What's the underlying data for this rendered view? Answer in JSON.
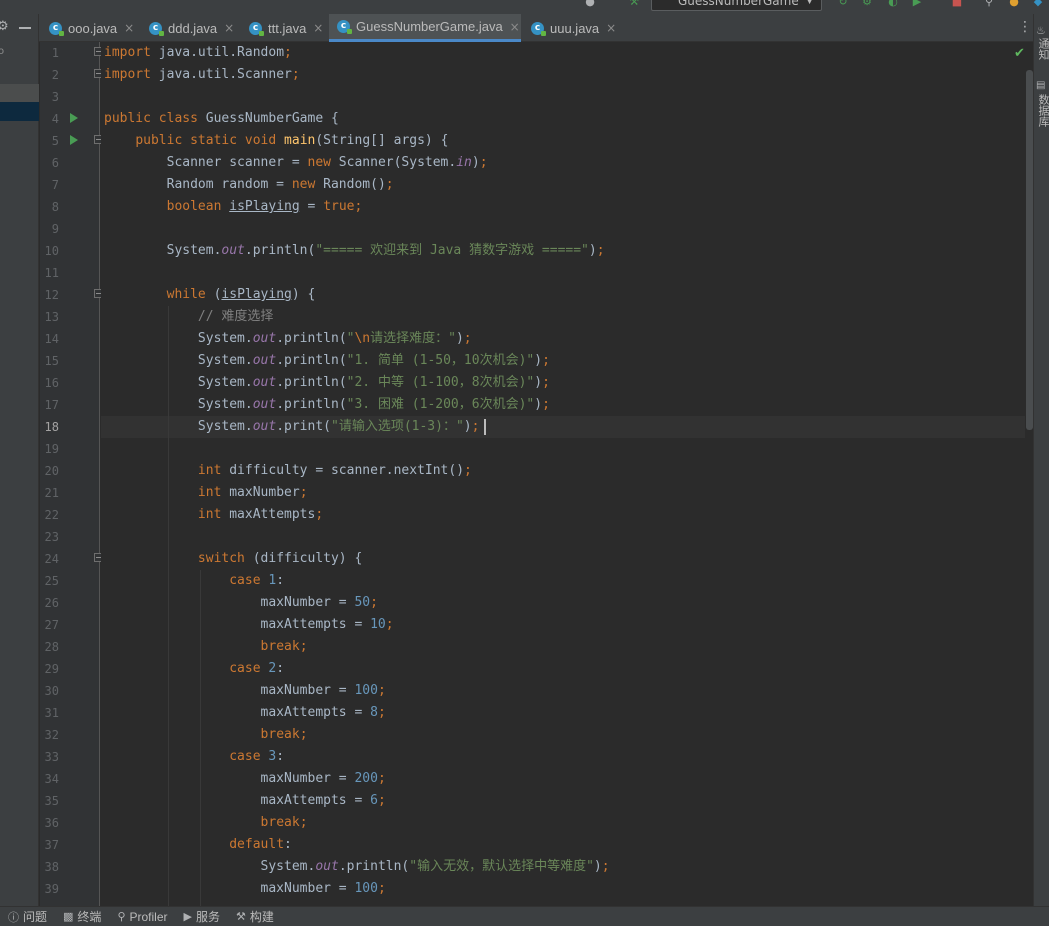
{
  "toolbar": {
    "run_config": "GuessNumberGame",
    "icons": [
      "user-icon",
      "hammer-icon",
      "run-icon",
      "debug-icon",
      "coverage-icon",
      "profile-icon",
      "stop-icon",
      "search-icon",
      "update-icon",
      "plugin-icon"
    ]
  },
  "tabs": [
    {
      "label": "ooo.java",
      "active": false
    },
    {
      "label": "ddd.java",
      "active": false
    },
    {
      "label": "ttt.java",
      "active": false
    },
    {
      "label": "GuessNumberGame.java",
      "active": true
    },
    {
      "label": "uuu.java",
      "active": false
    }
  ],
  "right_strip": {
    "notifications": "通知",
    "database": "数据库"
  },
  "editor": {
    "current_line": 18,
    "line_numbers": [
      "1",
      "2",
      "3",
      "4",
      "5",
      "6",
      "7",
      "8",
      "9",
      "10",
      "11",
      "12",
      "13",
      "14",
      "15",
      "16",
      "17",
      "18",
      "19",
      "20",
      "21",
      "22",
      "23",
      "24",
      "25",
      "26",
      "27",
      "28",
      "29",
      "30",
      "31",
      "32",
      "33",
      "34",
      "35",
      "36",
      "37",
      "38",
      "39"
    ],
    "lines": [
      "import java.util.Random;",
      "import java.util.Scanner;",
      "",
      "public class GuessNumberGame {",
      "    public static void main(String[] args) {",
      "        Scanner scanner = new Scanner(System.in);",
      "        Random random = new Random();",
      "        boolean isPlaying = true;",
      "",
      "        System.out.println(\"===== 欢迎来到 Java 猜数字游戏 =====\");",
      "",
      "        while (isPlaying) {",
      "            // 难度选择",
      "            System.out.println(\"\\n请选择难度：\");",
      "            System.out.println(\"1. 简单 (1-50，10次机会)\");",
      "            System.out.println(\"2. 中等 (1-100，8次机会)\");",
      "            System.out.println(\"3. 困难 (1-200，6次机会)\");",
      "            System.out.print(\"请输入选项(1-3)：\");",
      "",
      "            int difficulty = scanner.nextInt();",
      "            int maxNumber;",
      "            int maxAttempts;",
      "",
      "            switch (difficulty) {",
      "                case 1:",
      "                    maxNumber = 50;",
      "                    maxAttempts = 10;",
      "                    break;",
      "                case 2:",
      "                    maxNumber = 100;",
      "                    maxAttempts = 8;",
      "                    break;",
      "                case 3:",
      "                    maxNumber = 200;",
      "                    maxAttempts = 6;",
      "                    break;",
      "                default:",
      "                    System.out.println(\"输入无效，默认选择中等难度\");",
      "                    maxNumber = 100;"
    ]
  },
  "bottom_bar": {
    "problems": "问题",
    "terminal": "终端",
    "profiler": "Profiler",
    "services": "服务",
    "build": "构建"
  },
  "colors": {
    "keyword": "#cc7832",
    "string": "#6a8759",
    "number": "#6897bb",
    "field": "#9876aa",
    "method_decl": "#ffc66d",
    "comment": "#808080",
    "text": "#a9b7c6",
    "accent": "#4a88c7"
  }
}
